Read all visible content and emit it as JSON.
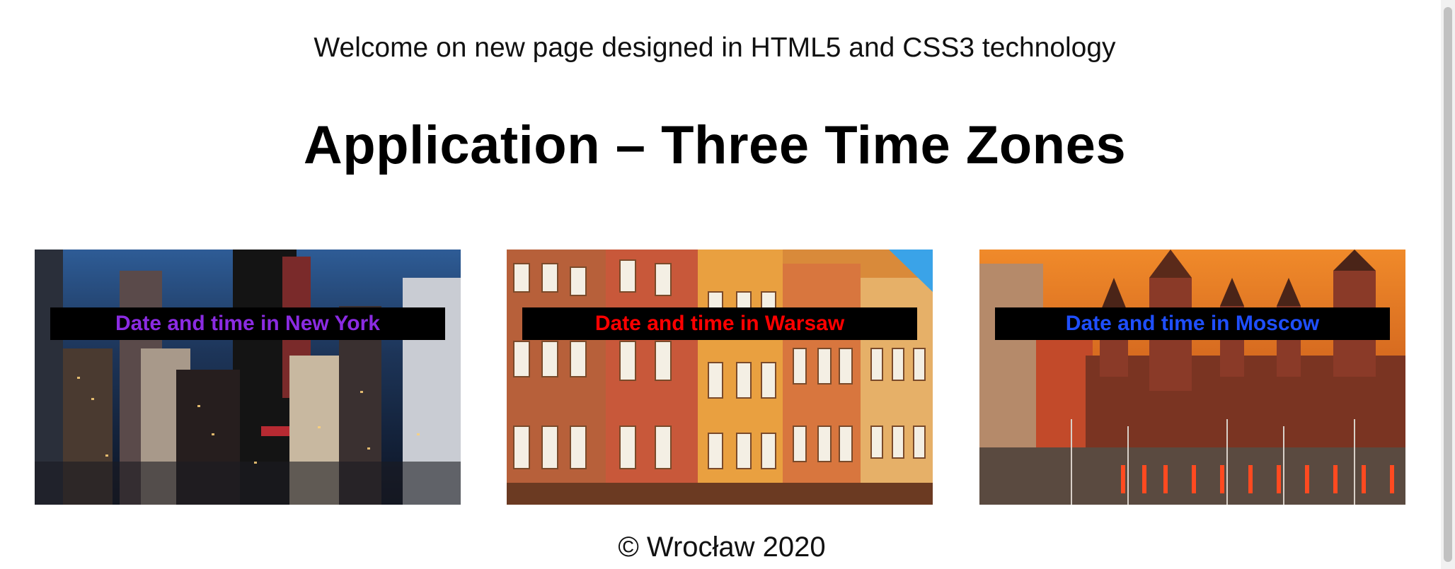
{
  "header": {
    "welcome_text": "Welcome on new page designed in HTML5 and CSS3 technology",
    "title": "Application – Three Time Zones"
  },
  "panels": [
    {
      "caption": "Date and time in New York",
      "caption_color": "#8b2be2",
      "photo": "new-york-night-skyline"
    },
    {
      "caption": "Date and time in Warsaw",
      "caption_color": "#ff0000",
      "photo": "warsaw-old-town-houses"
    },
    {
      "caption": "Date and time in Moscow",
      "caption_color": "#1f4fff",
      "photo": "moscow-kremlin-towers"
    }
  ],
  "footer": {
    "text": "© Wrocław 2020"
  }
}
